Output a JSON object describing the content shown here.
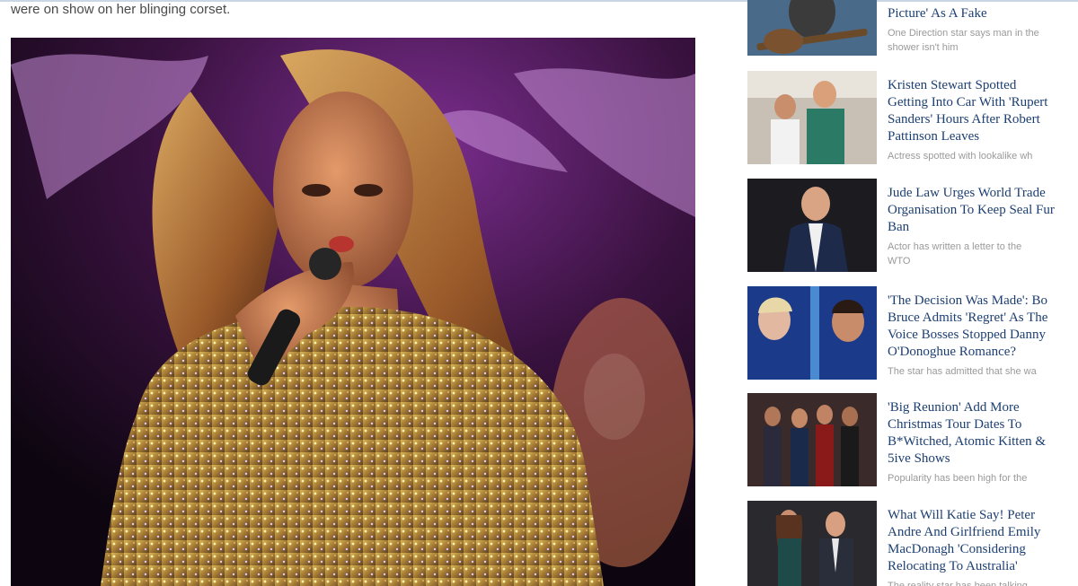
{
  "article": {
    "caption_fragment": "were on show on her blinging corset."
  },
  "sidebar": {
    "stories": [
      {
        "title": "Picture' As A Fake",
        "desc": "One Direction star says man in the\nshower isn't him",
        "thumb_icon": "guitarist-photo"
      },
      {
        "title": "Kristen Stewart Spotted\nGetting Into Car With 'Rupert\nSanders' Hours After Robert\nPattinson Leaves",
        "desc": "Actress spotted with lookalike wh",
        "thumb_icon": "street-couple-photo"
      },
      {
        "title": "Jude Law Urges World Trade\nOrganisation To Keep Seal Fur\nBan",
        "desc": "Actor has written a letter to the\nWTO",
        "thumb_icon": "man-in-suit-photo"
      },
      {
        "title": "'The Decision Was Made': Bo\nBruce Admits 'Regret' As The\nVoice Bosses Stopped Danny\nO'Donoghue Romance?",
        "desc": "The star has admitted that she wa",
        "thumb_icon": "duet-singers-photo"
      },
      {
        "title": "'Big Reunion' Add More\nChristmas Tour Dates To\nB*Witched, Atomic Kitten &\n5ive Shows",
        "desc": "Popularity has been high for the",
        "thumb_icon": "girl-group-photo"
      },
      {
        "title": "What Will Katie Say! Peter\nAndre And Girlfriend Emily\nMacDonagh 'Considering\nRelocating To Australia'",
        "desc": "The reality star has been talking",
        "thumb_icon": "couple-photo"
      }
    ]
  }
}
